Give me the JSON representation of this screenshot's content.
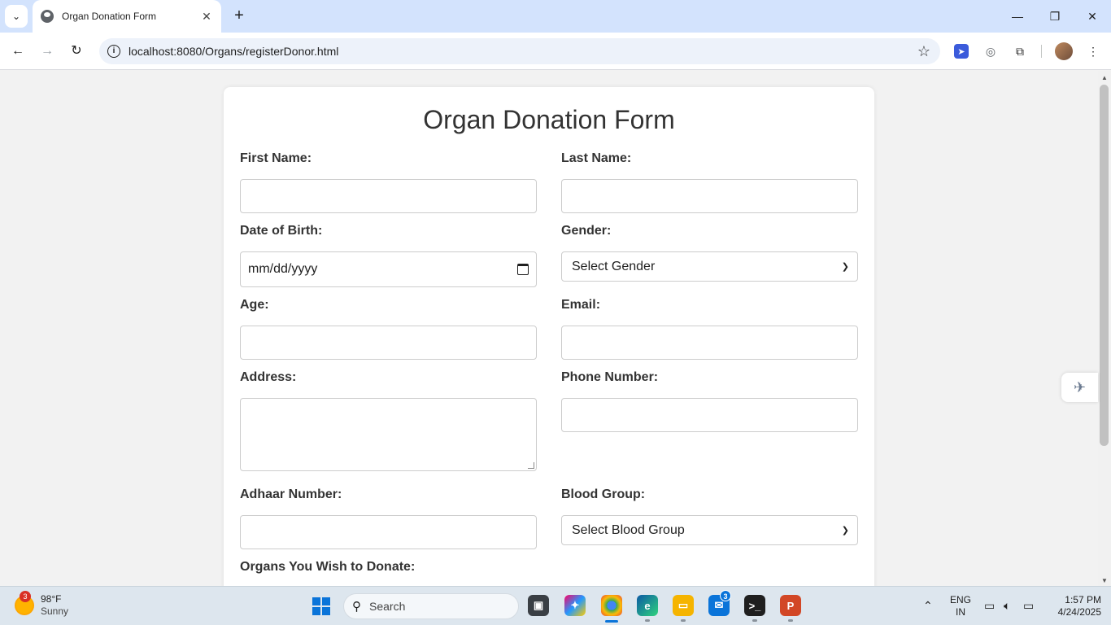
{
  "browser": {
    "tab_title": "Organ Donation Form",
    "url": "localhost:8080/Organs/registerDonor.html"
  },
  "form": {
    "title": "Organ Donation Form",
    "first_name_label": "First Name:",
    "last_name_label": "Last Name:",
    "dob_label": "Date of Birth:",
    "dob_placeholder": "mm/dd/yyyy",
    "gender_label": "Gender:",
    "gender_selected": "Select Gender",
    "age_label": "Age:",
    "email_label": "Email:",
    "address_label": "Address:",
    "phone_label": "Phone Number:",
    "adhaar_label": "Adhaar Number:",
    "blood_group_label": "Blood Group:",
    "blood_group_selected": "Select Blood Group",
    "organs_label": "Organs You Wish to Donate:"
  },
  "taskbar": {
    "weather_temp": "98°F",
    "weather_condition": "Sunny",
    "weather_badge": "3",
    "search_placeholder": "Search",
    "mail_badge": "3",
    "lang_line1": "ENG",
    "lang_line2": "IN",
    "time": "1:57 PM",
    "date": "4/24/2025"
  },
  "colors": {
    "tabbar_bg": "#d3e3fd",
    "page_bg": "#f2f2f2",
    "card_bg": "#ffffff",
    "text": "#333333",
    "field_border": "#cccccc"
  }
}
